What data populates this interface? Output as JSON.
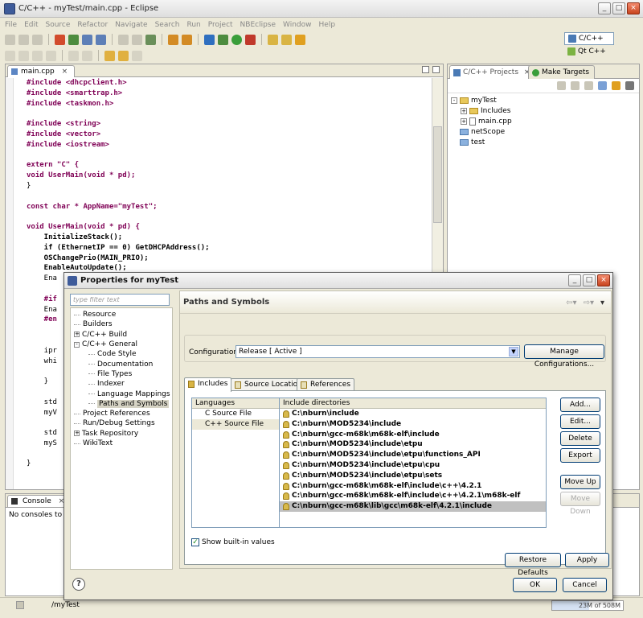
{
  "window": {
    "title": "C/C++ - myTest/main.cpp - Eclipse"
  },
  "menu": [
    "File",
    "Edit",
    "Source",
    "Refactor",
    "Navigate",
    "Search",
    "Run",
    "Project",
    "NBEclipse",
    "Window",
    "Help"
  ],
  "perspectives": {
    "active": "C/C++",
    "other": "Qt C++"
  },
  "editor": {
    "tab": "main.cpp",
    "lines": [
      "#include <dhcpclient.h>",
      "#include <smarttrap.h>",
      "#include <taskmon.h>",
      "",
      "#include <string>",
      "#include <vector>",
      "#include <iostream>",
      "",
      "extern \"C\" {",
      "void UserMain(void * pd);",
      "}",
      "",
      "const char * AppName=\"myTest\";",
      "",
      "void UserMain(void * pd) {",
      "    InitializeStack();",
      "    if (EthernetIP == 0) GetDHCPAddress();",
      "    OSChangePrio(MAIN_PRIO);",
      "    EnableAutoUpdate();",
      "    Ena",
      "",
      "    #if",
      "    Ena",
      "    #en",
      "",
      "",
      "    ipr",
      "    whi",
      "",
      "    }",
      "",
      "    std",
      "    myV",
      "",
      "    std",
      "    myS",
      "",
      "}"
    ]
  },
  "projects": {
    "tab_active": "C/C++ Projects",
    "tab_other": "Make Targets",
    "tree": [
      {
        "label": "myTest",
        "level": 0,
        "expander": "-",
        "icon": "project"
      },
      {
        "label": "Includes",
        "level": 1,
        "expander": "+",
        "icon": "folder"
      },
      {
        "label": "main.cpp",
        "level": 1,
        "expander": "+",
        "icon": "file"
      },
      {
        "label": "netScope",
        "level": 0,
        "expander": "",
        "icon": "folder-blue"
      },
      {
        "label": "test",
        "level": 0,
        "expander": "",
        "icon": "folder-blue"
      }
    ]
  },
  "console": {
    "tab": "Console",
    "message": "No consoles to disp"
  },
  "status": {
    "path": "/myTest",
    "heap": "23M of 508M"
  },
  "dialog": {
    "title": "Properties for myTest",
    "filter_placeholder": "type filter text",
    "nav": [
      {
        "label": "Resource",
        "level": 0,
        "exp": ""
      },
      {
        "label": "Builders",
        "level": 0,
        "exp": ""
      },
      {
        "label": "C/C++ Build",
        "level": 0,
        "exp": "+"
      },
      {
        "label": "C/C++ General",
        "level": 0,
        "exp": "-"
      },
      {
        "label": "Code Style",
        "level": 1,
        "exp": ""
      },
      {
        "label": "Documentation",
        "level": 1,
        "exp": ""
      },
      {
        "label": "File Types",
        "level": 1,
        "exp": ""
      },
      {
        "label": "Indexer",
        "level": 1,
        "exp": ""
      },
      {
        "label": "Language Mappings",
        "level": 1,
        "exp": ""
      },
      {
        "label": "Paths and Symbols",
        "level": 1,
        "exp": "",
        "selected": true
      },
      {
        "label": "Project References",
        "level": 0,
        "exp": ""
      },
      {
        "label": "Run/Debug Settings",
        "level": 0,
        "exp": ""
      },
      {
        "label": "Task Repository",
        "level": 0,
        "exp": "+"
      },
      {
        "label": "WikiText",
        "level": 0,
        "exp": ""
      }
    ],
    "pane_title": "Paths and Symbols",
    "config_label": "Configuration:",
    "config_value": "Release  [ Active ]",
    "manage_button": "Manage Configurations...",
    "tabs": [
      "Includes",
      "Source Location",
      "References"
    ],
    "languages_header": "Languages",
    "languages": [
      "C Source File",
      "C++ Source File"
    ],
    "includes_header": "Include directories",
    "includes": [
      "C:\\nburn\\include",
      "C:\\nburn\\MOD5234\\include",
      "C:\\nburn\\gcc-m68k\\m68k-elf\\include",
      "C:\\nburn\\MOD5234\\include\\etpu",
      "C:\\nburn\\MOD5234\\include\\etpu\\functions_API",
      "C:\\nburn\\MOD5234\\include\\etpu\\cpu",
      "C:\\nburn\\MOD5234\\include\\etpu\\sets",
      "C:\\nburn\\gcc-m68k\\m68k-elf\\include\\c++\\4.2.1",
      "C:\\nburn\\gcc-m68k\\m68k-elf\\include\\c++\\4.2.1\\m68k-elf",
      "C:\\nburn\\gcc-m68k\\lib\\gcc\\m68k-elf\\4.2.1\\include"
    ],
    "buttons": {
      "add": "Add...",
      "edit": "Edit...",
      "delete": "Delete",
      "export": "Export",
      "move_up": "Move Up",
      "move_down": "Move Down",
      "restore": "Restore Defaults",
      "apply": "Apply",
      "ok": "OK",
      "cancel": "Cancel"
    },
    "show_builtin": "Show built-in values"
  }
}
